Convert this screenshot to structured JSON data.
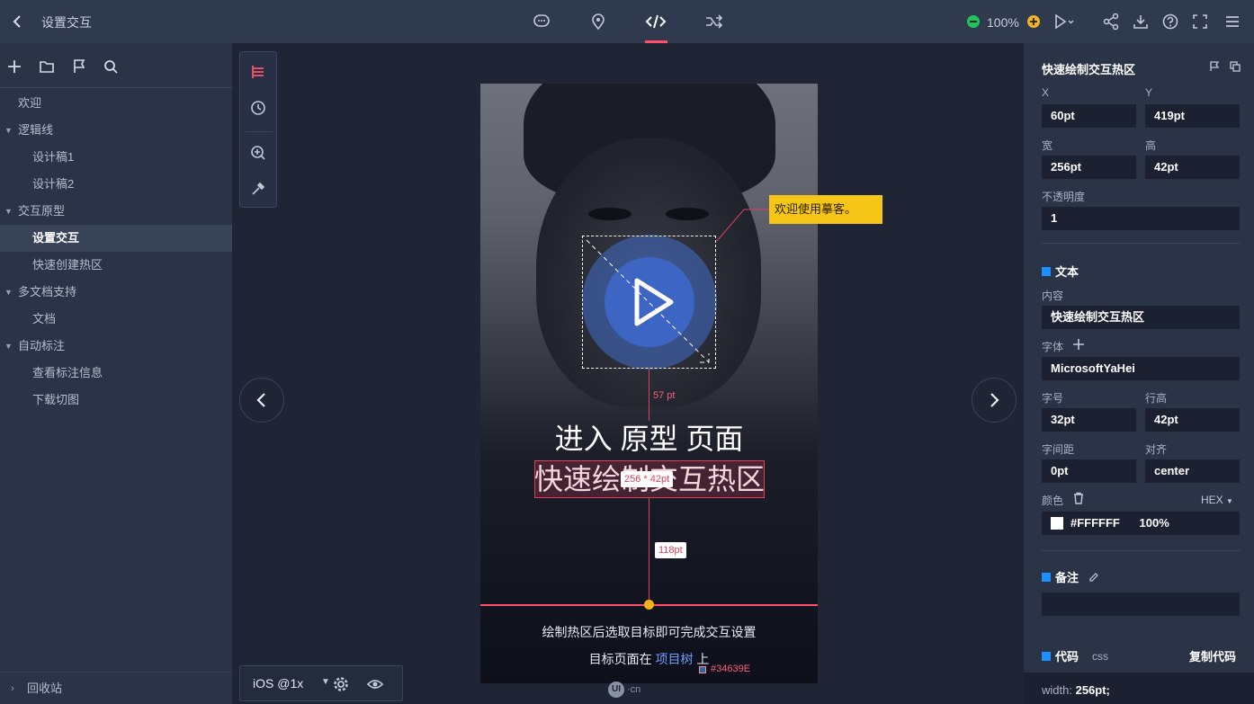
{
  "header": {
    "title": "设置交互",
    "zoom": "100%",
    "center_tools": [
      "comment-icon",
      "location-pin-icon",
      "code-icon",
      "shuffle-icon"
    ],
    "right_tools": [
      "play-icon",
      "share-icon",
      "download-icon",
      "help-icon",
      "fullscreen-icon",
      "menu-icon"
    ]
  },
  "sidebar": {
    "items": [
      {
        "label": "欢迎",
        "level": 0
      },
      {
        "label": "逻辑线",
        "level": 0,
        "expanded": true
      },
      {
        "label": "设计稿1",
        "level": 1
      },
      {
        "label": "设计稿2",
        "level": 1
      },
      {
        "label": "交互原型",
        "level": 0,
        "expanded": true
      },
      {
        "label": "设置交互",
        "level": 1,
        "selected": true
      },
      {
        "label": "快速创建热区",
        "level": 1
      },
      {
        "label": "多文档支持",
        "level": 0,
        "expanded": true
      },
      {
        "label": "文档",
        "level": 1
      },
      {
        "label": "自动标注",
        "level": 0,
        "expanded": true
      },
      {
        "label": "查看标注信息",
        "level": 1
      },
      {
        "label": "下载切图",
        "level": 1
      }
    ],
    "recycle": "回收站"
  },
  "canvas": {
    "device": "iOS @1x",
    "logo": "UI·cn",
    "tooltip": "欢迎使用摹客。",
    "screen": {
      "headline": "进入 原型 页面",
      "hotspot_text": "快速绘制交互热区",
      "dimension_badge": "256 * 42pt",
      "distance_top": "57 pt",
      "distance_bottom": "118pt",
      "footer_line1": "绘制热区后选取目标即可完成交互设置",
      "footer_line2_prefix": "目标页面在",
      "footer_line2_link": "项目树",
      "footer_line2_suffix": "上",
      "color_label": "#34639E"
    }
  },
  "panel": {
    "title": "快速绘制交互热区",
    "x_label": "X",
    "x": "60pt",
    "y_label": "Y",
    "y": "419pt",
    "w_label": "宽",
    "w": "256pt",
    "h_label": "高",
    "h": "42pt",
    "opacity_label": "不透明度",
    "opacity": "1",
    "text_section": "文本",
    "content_label": "内容",
    "content": "快速绘制交互热区",
    "font_label": "字体",
    "font": "MicrosoftYaHei",
    "size_label": "字号",
    "size": "32pt",
    "line_height_label": "行高",
    "line_height": "42pt",
    "spacing_label": "字间距",
    "spacing": "0pt",
    "align_label": "对齐",
    "align": "center",
    "color_label": "颜色",
    "color_mode": "HEX",
    "color_hex": "#FFFFFF",
    "color_opacity": "100%",
    "note_section": "备注",
    "code_section": "代码",
    "code_lang": "css",
    "copy_code": "复制代码",
    "code_key": "width:",
    "code_value": "256pt;"
  },
  "colors": {
    "accent": "#ff4f6b",
    "hotspot": "#e0405a",
    "link": "#6b9cff",
    "tooltip": "#f5c518",
    "section_marker": "#1e90ff"
  }
}
